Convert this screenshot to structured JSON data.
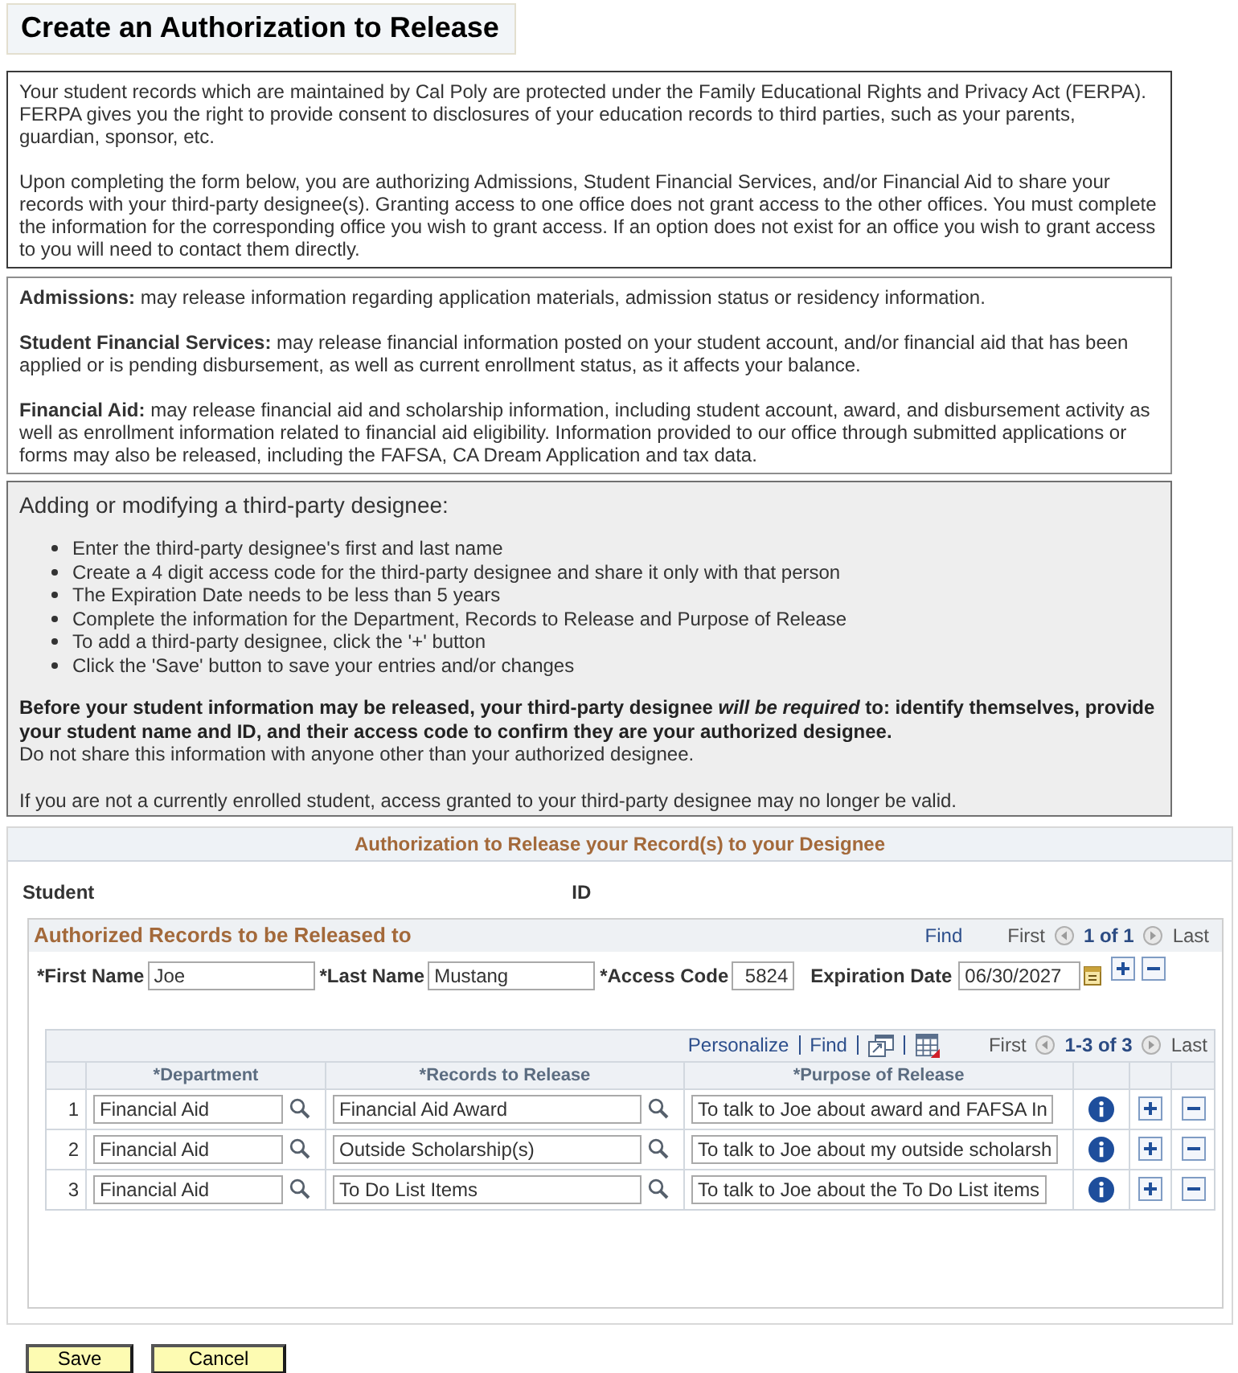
{
  "page_title": "Create an Authorization to Release",
  "intro": [
    "Your student records which are maintained by Cal Poly are protected under the Family Educational Rights and Privacy Act (FERPA). FERPA gives you the right to provide consent to disclosures of your education records to third parties, such as your parents, guardian, sponsor, etc.",
    "Upon completing the form below, you are authorizing Admissions, Student Financial Services, and/or Financial Aid to share your records with your third-party designee(s). Granting access to one office does not grant access to the other offices. You must complete the information for the corresponding office you wish to grant access. If an option does not exist for an office you wish to grant access to you will need to contact them directly."
  ],
  "offices": [
    {
      "name": "Admissions:",
      "text": "may release information regarding application materials, admission status or residency information."
    },
    {
      "name": "Student Financial Services:",
      "text": "may release financial information posted on your student account, and/or financial aid that has been applied or is pending disbursement, as well as current enrollment status, as it affects your balance."
    },
    {
      "name": "Financial Aid:",
      "text": "may release financial aid and scholarship information, including student account, award, and disbursement activity as well as enrollment information related to financial aid eligibility. Information provided to our office through submitted applications or forms may also be released, including the FAFSA, CA Dream Application and tax data."
    }
  ],
  "instructions": {
    "heading": "Adding or modifying a third-party designee:",
    "steps": [
      "Enter the third-party designee's first and last name",
      "Create a 4 digit access code for the third-party designee and share it only with that person",
      "The Expiration Date needs to be less than 5 years",
      "Complete the information for the Department, Records to Release and Purpose of Release",
      "To add a third-party designee, click the '+' button",
      "Click the 'Save' button to save your entries and/or changes"
    ],
    "notice": "Before your student information may be released, your third-party designee *will be required* to: identify themselves, provide your student name and ID, and their access code to confirm they are your authorized designee.",
    "warning": "Do not share this information with anyone other than your authorized designee.",
    "note": "If you are not a currently enrolled student, access granted to your third-party designee may no longer be valid."
  },
  "authorization": {
    "title": "Authorization to Release your Record(s) to your Designee",
    "student_label": "Student",
    "id_label": "ID",
    "records": {
      "title": "Authorized Records to be Released to",
      "find": "Find",
      "first": "First",
      "count": "1 of 1",
      "last": "Last",
      "fields": [
        {
          "kind": "text",
          "label": "*First Name",
          "value": "Joe"
        },
        {
          "kind": "text",
          "label": "*Last Name",
          "value": "Mustang"
        },
        {
          "kind": "code",
          "label": "*Access Code",
          "value": "5824"
        },
        {
          "kind": "date",
          "label": "Expiration Date",
          "value": "06/30/2027"
        }
      ],
      "grid": {
        "personalize": "Personalize",
        "find": "Find",
        "first": "First",
        "count": "1-3 of 3",
        "last": "Last",
        "columns": [
          "*Department",
          "*Records to Release",
          "*Purpose of Release"
        ],
        "rows": [
          {
            "number": "1",
            "department": "Financial Aid",
            "records": "Financial Aid Award",
            "purpose": "To talk to Joe about award and FAFSA In"
          },
          {
            "number": "2",
            "department": "Financial Aid",
            "records": "Outside Scholarship(s)",
            "purpose": "To talk to Joe about my outside scholarsh"
          },
          {
            "number": "3",
            "department": "Financial Aid",
            "records": "To Do List Items",
            "purpose": "To talk to Joe about the To Do List items"
          }
        ]
      }
    }
  },
  "buttons": [
    "Save",
    "Cancel"
  ]
}
